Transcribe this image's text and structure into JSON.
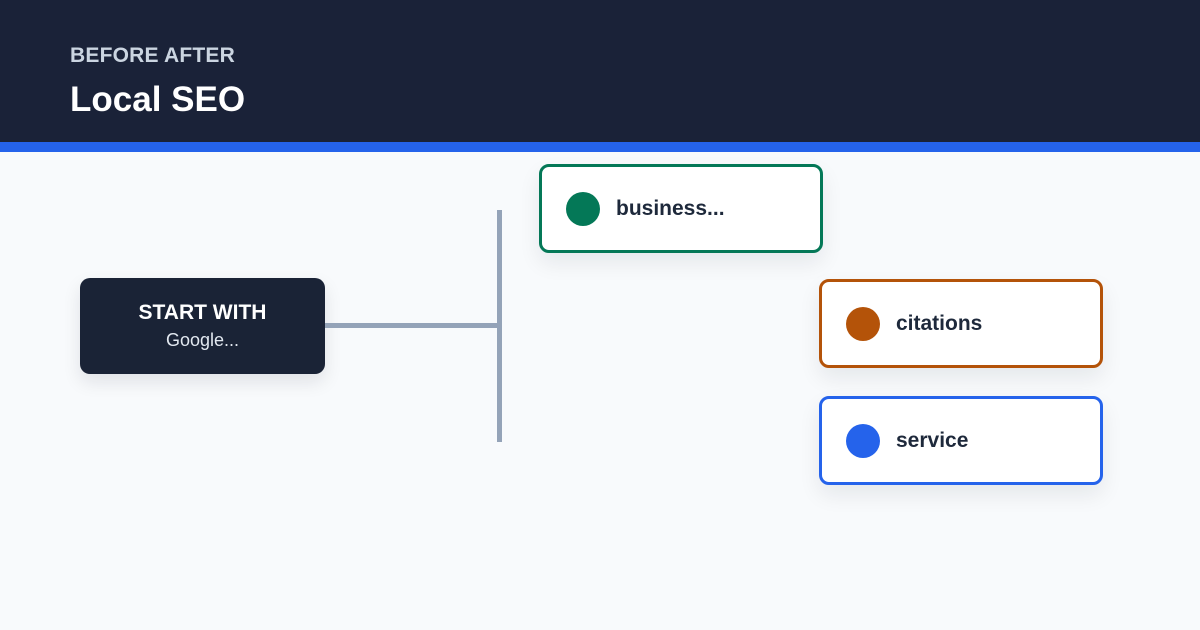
{
  "header": {
    "eyebrow": "BEFORE AFTER",
    "title": "Local SEO"
  },
  "diagram": {
    "start": {
      "label": "START WITH",
      "sublabel": "Google..."
    },
    "branches": [
      {
        "label": "business...",
        "color": "#047857"
      },
      {
        "label": "citations",
        "color": "#b45309"
      },
      {
        "label": "service",
        "color": "#2563eb"
      }
    ],
    "connector_color": "#94a3b8"
  },
  "colors": {
    "header_bg": "#1a2238",
    "accent": "#2563eb",
    "page_bg": "#f8fafc",
    "node_dark": "#1a2336"
  }
}
